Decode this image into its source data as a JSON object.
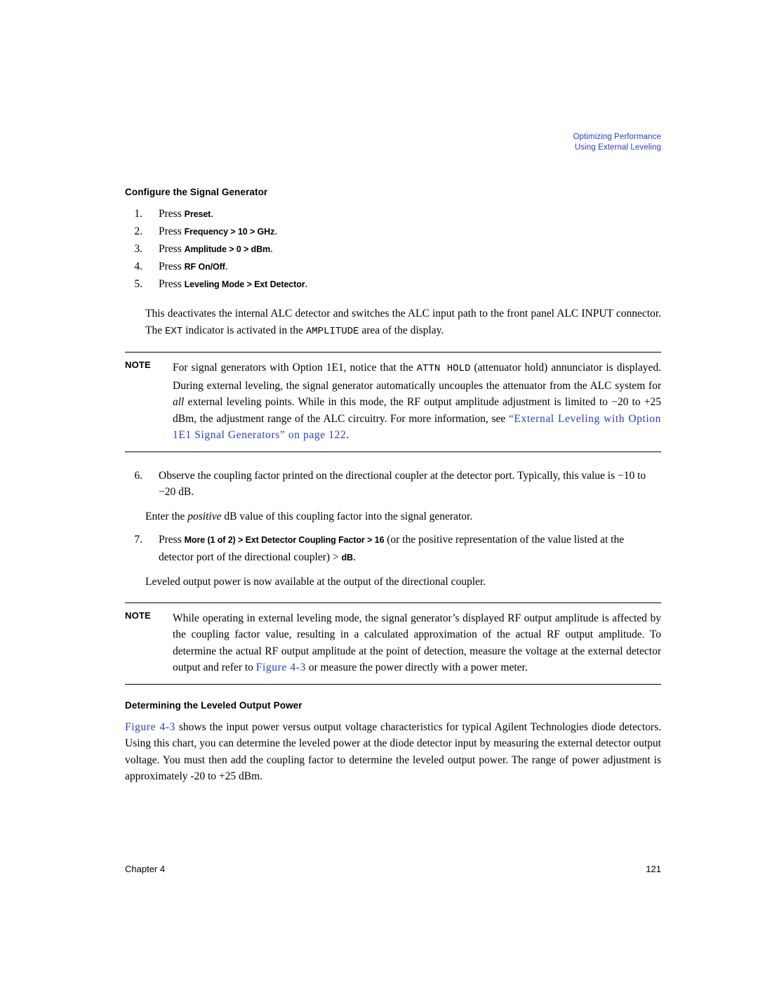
{
  "header": {
    "line1": "Optimizing Performance",
    "line2": "Using External Leveling",
    "color": "#2d3bbf"
  },
  "section1": {
    "heading": "Configure the Signal Generator",
    "steps": [
      {
        "num": "1.",
        "press": "Press",
        "keys": "Preset",
        "tail": "."
      },
      {
        "num": "2.",
        "press": "Press",
        "keys": "Frequency > 10 > GHz",
        "tail": "."
      },
      {
        "num": "3.",
        "press": "Press",
        "keys": "Amplitude > 0 > dBm",
        "tail": "."
      },
      {
        "num": "4.",
        "press": "Press",
        "keys": "RF On/Off",
        "tail": "."
      },
      {
        "num": "5.",
        "press": "Press",
        "keys": "Leveling Mode > Ext Detector",
        "tail": "."
      }
    ],
    "para1_a": "This deactivates the internal ALC detector and switches the ALC input path to the front panel ALC INPUT connector. The ",
    "para1_mono1": "EXT",
    "para1_b": " indicator is activated in the ",
    "para1_mono2": "AMPLITUDE",
    "para1_c": " area of the display."
  },
  "note1": {
    "label": "NOTE",
    "text_a": "For signal generators with Option 1E1, notice that the ",
    "mono1": "ATTN HOLD",
    "text_b": " (attenuator hold) annunciator is displayed. During external leveling, the signal generator automatically uncouples the attenuator from the ALC system for ",
    "ital1": "all",
    "text_c": " external leveling points. While in this mode, the RF output amplitude adjustment is limited to −20 to +25 dBm, the adjustment range of the ALC circuitry. For more information, see ",
    "link1": "“External Leveling with Option 1E1 Signal Generators” on page 122",
    "text_d": "."
  },
  "section2": {
    "step6_num": "6.",
    "step6": "Observe the coupling factor printed on the directional coupler at the detector port. Typically, this value is −10 to −20 dB.",
    "para_enter_a": "Enter the ",
    "para_enter_ital": "positive",
    "para_enter_b": " dB value of this coupling factor into the signal generator.",
    "step7_num": "7.",
    "step7_press": "Press",
    "step7_keys": "More (1 of 2) > Ext Detector Coupling Factor > 16",
    "step7_mid": " (or the positive representation of the value listed at the detector port of the directional coupler) > ",
    "step7_keys2": "dB",
    "step7_tail": ".",
    "para_leveled": "Leveled output power is now available at the output of the directional coupler."
  },
  "note2": {
    "label": "NOTE",
    "text_a": "While operating in external leveling mode, the signal generator’s displayed RF output amplitude is affected by the coupling factor value, resulting in a calculated approximation of the actual RF output amplitude. To determine the actual RF output amplitude at the point of detection, measure the voltage at the external detector output and refer to ",
    "link1": "Figure 4-3",
    "text_b": " or measure the power directly with a power meter."
  },
  "section3": {
    "heading": "Determining the Leveled Output Power",
    "link1": "Figure 4-3",
    "para_a": " shows the input power versus output voltage characteristics for typical Agilent Technologies diode detectors. Using this chart, you can determine the leveled power at the diode detector input by measuring the external detector output voltage. You must then add the coupling factor to determine the leveled output power. The range of power adjustment is approximately -20 to +25 dBm."
  },
  "footer": {
    "left": "Chapter 4",
    "right": "121"
  }
}
